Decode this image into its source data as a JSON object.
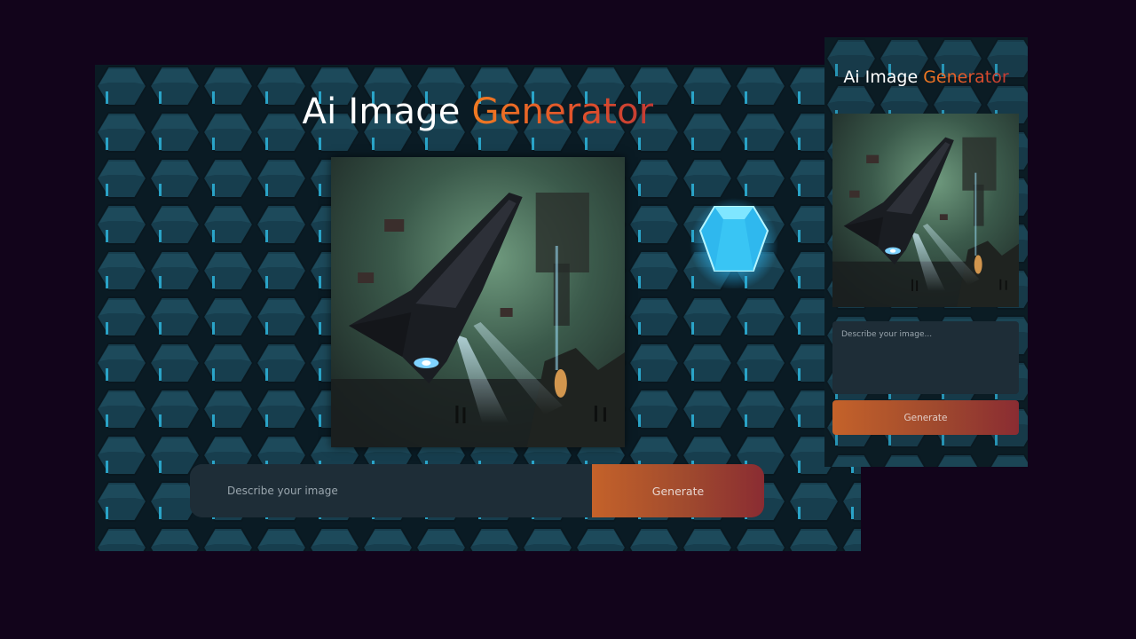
{
  "app": {
    "title_plain": "Ai Image ",
    "title_accent": "Generator"
  },
  "desktop": {
    "prompt_placeholder": "Describe your image",
    "generate_label": "Generate"
  },
  "mobile": {
    "prompt_placeholder": "Describe your image...",
    "generate_label": "Generate"
  },
  "colors": {
    "page_background": "#12041b",
    "panel_background": "#1e2d37",
    "accent_start": "#f07a22",
    "accent_end": "#8a2c32",
    "hex_glow": "#2fd3ff"
  },
  "images": {
    "generated_art": "spaceship-illustration",
    "background": "glowing-hexagon-tiles",
    "decoration": "glowing-hexagonal-crystal"
  }
}
